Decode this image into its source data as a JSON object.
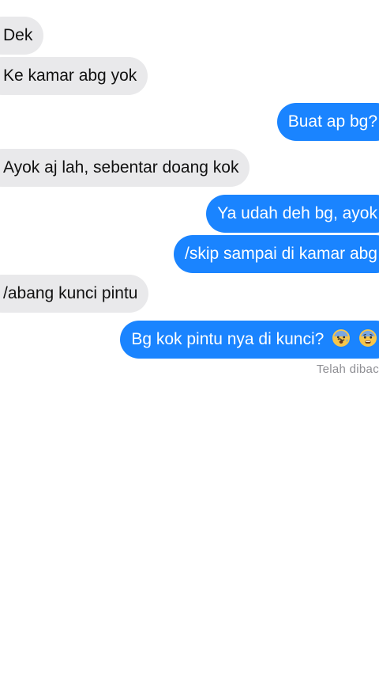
{
  "messages": [
    {
      "from": "other",
      "text": "Dek"
    },
    {
      "from": "other",
      "text": "Ke kamar abg yok"
    },
    {
      "from": "me",
      "text": "Buat ap bg?"
    },
    {
      "from": "other",
      "text": "Ayok aj lah, sebentar doang kok"
    },
    {
      "from": "me",
      "text": "Ya udah deh bg, ayok"
    },
    {
      "from": "me",
      "text": "/skip sampai di kamar abg"
    },
    {
      "from": "other",
      "text": "/abang kunci pintu"
    },
    {
      "from": "me",
      "text": "Bg kok pintu nya di kunci?",
      "emoji": [
        "anxious-face-icon",
        "fearful-face-icon"
      ]
    }
  ],
  "read_receipt": "Telah dibac",
  "colors": {
    "outgoing_bubble": "#1a84ff",
    "incoming_bubble": "#e9e9eb",
    "receipt_text": "#8e8e93"
  }
}
